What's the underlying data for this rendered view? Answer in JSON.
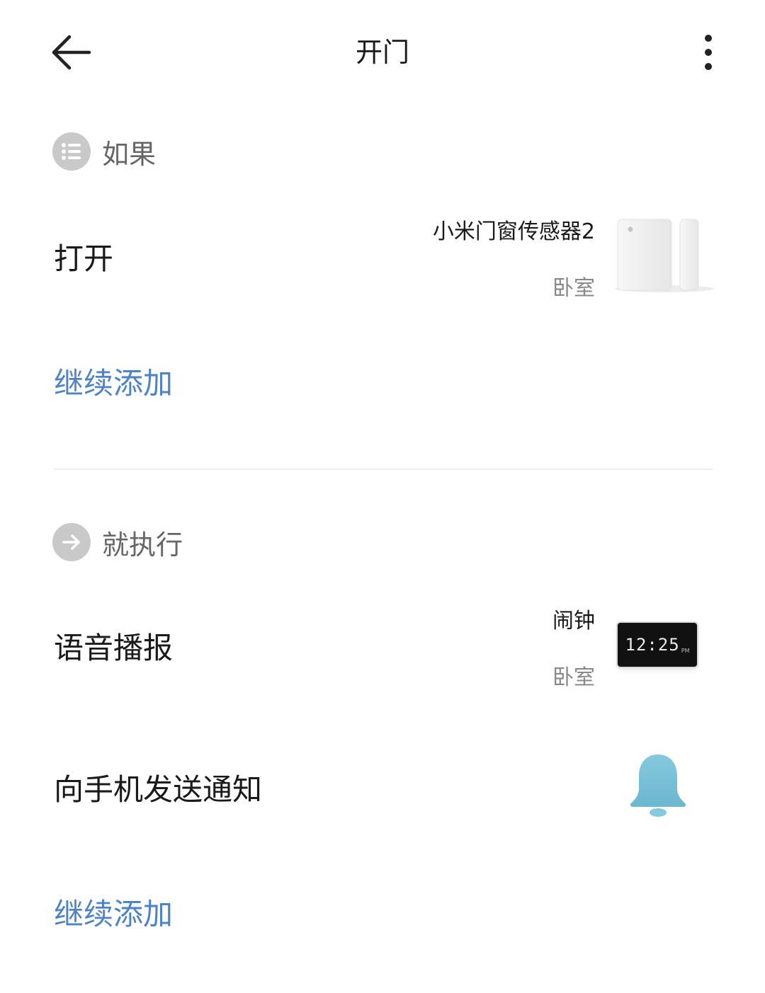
{
  "header": {
    "title": "开门",
    "back_icon": "arrow-left-icon",
    "more_icon": "more-vertical-icon"
  },
  "if_section": {
    "label": "如果",
    "icon": "list-icon",
    "conditions": [
      {
        "label": "打开",
        "device_name": "小米门窗传感器2",
        "room": "卧室",
        "device_icon": "door-window-sensor-icon"
      }
    ],
    "add_label": "继续添加"
  },
  "then_section": {
    "label": "就执行",
    "icon": "arrow-right-icon",
    "actions": [
      {
        "label": "语音播报",
        "device_name": "闹钟",
        "room": "卧室",
        "device_icon": "alarm-clock-icon",
        "clock_display": "12:25",
        "clock_suffix": "PM"
      },
      {
        "label": "向手机发送通知",
        "device_icon": "bell-icon"
      }
    ],
    "add_label": "继续添加"
  },
  "colors": {
    "link": "#4f83c4",
    "section_icon_bg": "#c9c9c9",
    "bell": "#7fc3da",
    "divider": "#ececec"
  }
}
